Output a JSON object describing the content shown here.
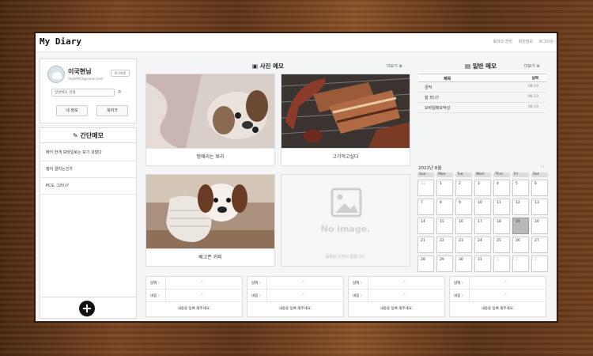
{
  "app": {
    "title": "My Diary",
    "links": [
      "북마크 관리",
      "회원정보",
      "로그아웃"
    ]
  },
  "profile": {
    "name": "이국현님",
    "email": "theheft03@naver.com",
    "logout_label": "로그아웃",
    "search_placeholder": "일반메모 검색",
    "info_btn": "내 정보",
    "bookmark_btn": "북마크"
  },
  "quick_memo": {
    "title": "간단메모",
    "items": [
      "에키 한개 모바일로는 보기 괴철다",
      "행어 결리는건가",
      "PC도 그러나?"
    ]
  },
  "photo_memo": {
    "title": "사진 메모",
    "more": "더보기 ⊕",
    "cards": [
      {
        "caption": "멍때리는 보리"
      },
      {
        "caption": "고기먹고싶다"
      },
      {
        "caption": "배고픈 커피"
      },
      {
        "caption": "등록된 사진이 없습니다.",
        "noimage": "No image."
      }
    ]
  },
  "normal_memo": {
    "title": "일반 메모",
    "more": "더보기 ⊕",
    "headers": [
      "제목",
      "날짜"
    ],
    "rows": [
      [
        "곰적",
        "08-19"
      ],
      [
        "잘 되나?",
        "08-19"
      ],
      [
        "모바일메모작성",
        "08-19"
      ]
    ]
  },
  "calendar": {
    "month_label": "2022년 8월",
    "nav": "‹ ›",
    "weekdays": [
      "Sun",
      "Mon",
      "Tue",
      "Wed",
      "Thrs",
      "Fri",
      "Sat"
    ],
    "days": [
      "31",
      "1",
      "2",
      "3",
      "4",
      "5",
      "6",
      "7",
      "8",
      "9",
      "10",
      "11",
      "12",
      "13",
      "14",
      "15",
      "16",
      "17",
      "18",
      "19",
      "20",
      "21",
      "22",
      "23",
      "24",
      "25",
      "26",
      "27",
      "28",
      "29",
      "30",
      "31",
      "1",
      "2",
      "3"
    ]
  },
  "bottom_cards": [
    {
      "date_label": "날짜 :",
      "content_label": "내용 :",
      "dash": "-",
      "footer": "내용을 등록 해주세요."
    },
    {
      "date_label": "날짜 :",
      "content_label": "내용 :",
      "dash": "-",
      "footer": "내용을 등록 해주세요."
    },
    {
      "date_label": "날짜 :",
      "content_label": "내용 :",
      "dash": "-",
      "footer": "내용을 등록 해주세요."
    },
    {
      "date_label": "날짜 :",
      "content_label": "내용 :",
      "dash": "-",
      "footer": "내용을 등록 해주세요."
    }
  ]
}
